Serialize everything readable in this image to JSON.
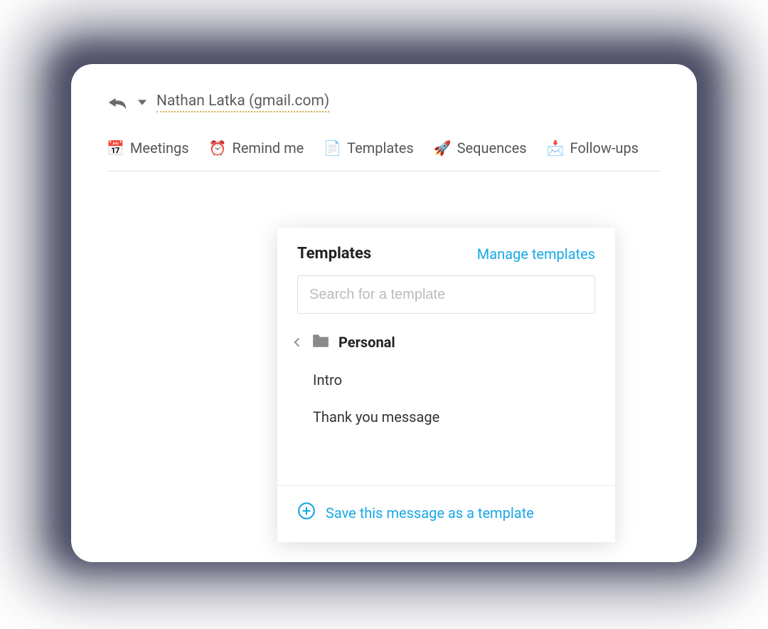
{
  "recipient": "Nathan Latka (gmail.com)",
  "toolbar": {
    "meetings": "Meetings",
    "remind": "Remind me",
    "templates": "Templates",
    "sequences": "Sequences",
    "followups": "Follow-ups"
  },
  "dropdown": {
    "title": "Templates",
    "manage": "Manage templates",
    "search_placeholder": "Search for a template",
    "folder": "Personal",
    "items": [
      "Intro",
      "Thank you message"
    ],
    "save": "Save this message as a template"
  },
  "colors": {
    "accent": "#18a8e6"
  }
}
